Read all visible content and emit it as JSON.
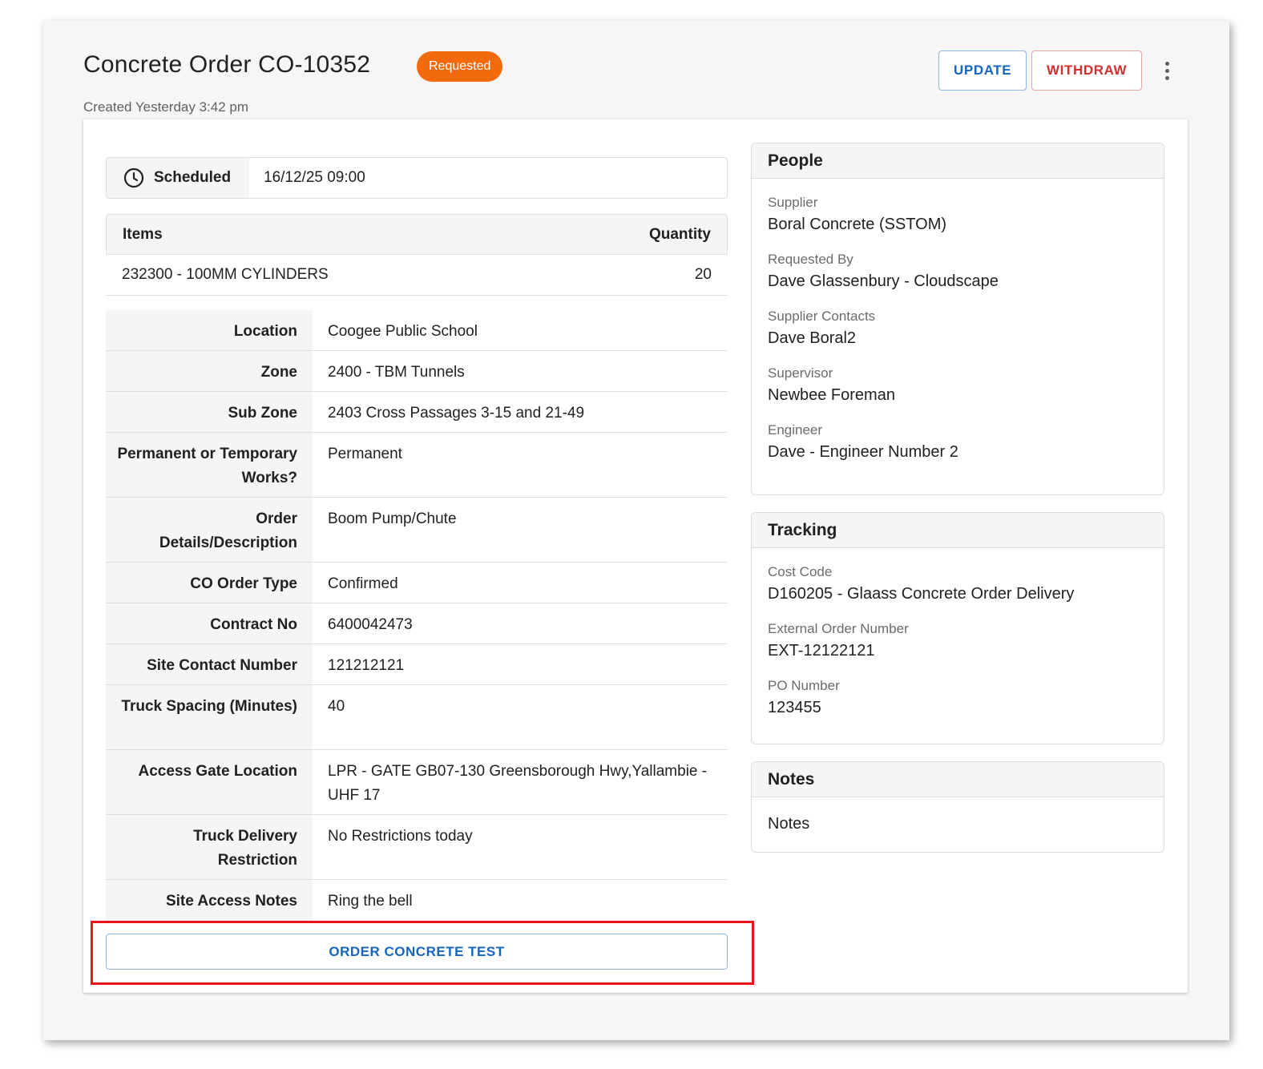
{
  "header": {
    "title": "Concrete Order CO-10352",
    "status": "Requested",
    "created": "Created Yesterday 3:42 pm",
    "update_label": "UPDATE",
    "withdraw_label": "WITHDRAW"
  },
  "scheduled": {
    "label": "Scheduled",
    "value": "16/12/25 09:00"
  },
  "items_table": {
    "headers": [
      "Items",
      "Quantity"
    ],
    "rows": [
      {
        "item": "232300 - 100MM CYLINDERS",
        "quantity": "20"
      }
    ]
  },
  "details": [
    {
      "label": "Location",
      "value": "Coogee Public School"
    },
    {
      "label": "Zone",
      "value": "2400 - TBM Tunnels"
    },
    {
      "label": "Sub Zone",
      "value": "2403 Cross Passages 3-15 and 21-49"
    },
    {
      "label": "Permanent or Temporary Works?",
      "value": "Permanent"
    },
    {
      "label": "Order Details/Description",
      "value": "Boom Pump/Chute"
    },
    {
      "label": "CO Order Type",
      "value": "Confirmed"
    },
    {
      "label": "Contract No",
      "value": "6400042473"
    },
    {
      "label": "Site Contact Number",
      "value": "121212121"
    },
    {
      "label": "Truck Spacing (Minutes)",
      "value": "40"
    },
    {
      "label": "Access Gate Location",
      "value": "LPR - GATE GB07-130 Greensborough Hwy,Yallambie - UHF 17"
    },
    {
      "label": "Truck Delivery Restriction",
      "value": "No Restrictions today"
    },
    {
      "label": "Site Access Notes",
      "value": "Ring the bell"
    }
  ],
  "order_test_label": "ORDER CONCRETE TEST",
  "people": {
    "title": "People",
    "fields": [
      {
        "label": "Supplier",
        "value": "Boral Concrete (SSTOM)"
      },
      {
        "label": "Requested By",
        "value": "Dave Glassenbury - Cloudscape"
      },
      {
        "label": "Supplier Contacts",
        "value": "Dave Boral2"
      },
      {
        "label": "Supervisor",
        "value": "Newbee Foreman"
      },
      {
        "label": "Engineer",
        "value": "Dave - Engineer Number 2"
      }
    ]
  },
  "tracking": {
    "title": "Tracking",
    "fields": [
      {
        "label": "Cost Code",
        "value": "D160205 - Glaass Concrete Order Delivery"
      },
      {
        "label": "External Order Number",
        "value": "EXT-12122121"
      },
      {
        "label": "PO Number",
        "value": "123455"
      }
    ]
  },
  "notes": {
    "title": "Notes",
    "value": "Notes"
  },
  "colors": {
    "status_badge": "#f26a0b",
    "primary": "#1565c0",
    "danger": "#d32f2f",
    "highlight": "#e8151b"
  },
  "icons": {
    "scheduled": "clock-icon",
    "more": "more-vert-icon"
  }
}
